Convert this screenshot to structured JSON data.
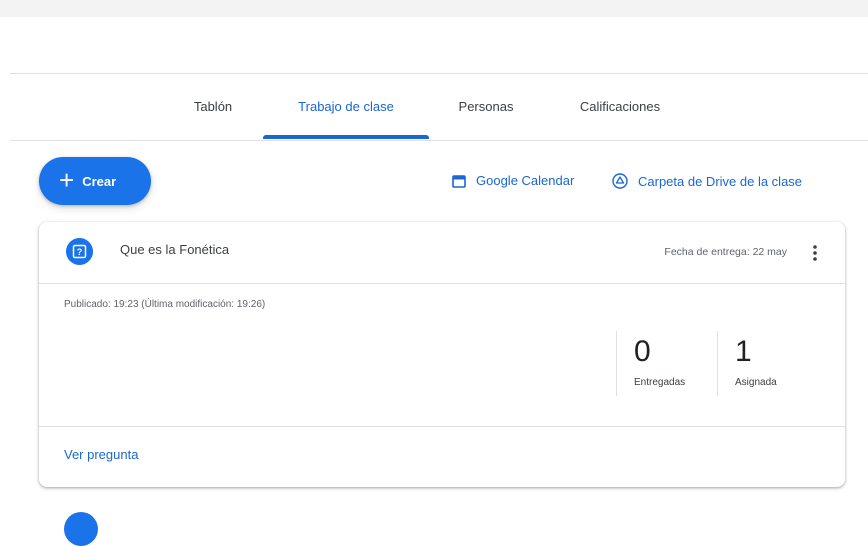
{
  "tabs": [
    {
      "label": "Tablón"
    },
    {
      "label": "Trabajo de clase",
      "active": true
    },
    {
      "label": "Personas"
    },
    {
      "label": "Calificaciones"
    }
  ],
  "create_button": {
    "label": "Crear",
    "icon": "plus-icon"
  },
  "links": {
    "calendar": {
      "label": "Google Calendar",
      "icon": "calendar-icon"
    },
    "drive": {
      "label": "Carpeta de Drive de la clase",
      "icon": "drive-icon"
    }
  },
  "assignment": {
    "icon": "question-icon",
    "title": "Que es la Fonética",
    "due": "Fecha de entrega: 22 may",
    "published": "Publicado: 19:23 (Última modificación: 19:26)",
    "stats": [
      {
        "count": "0",
        "label": "Entregadas"
      },
      {
        "count": "1",
        "label": "Asignada"
      }
    ],
    "view_link": "Ver pregunta"
  },
  "colors": {
    "accent": "#1a73e8",
    "link": "#1967d2",
    "divider": "#e0e0e0"
  }
}
